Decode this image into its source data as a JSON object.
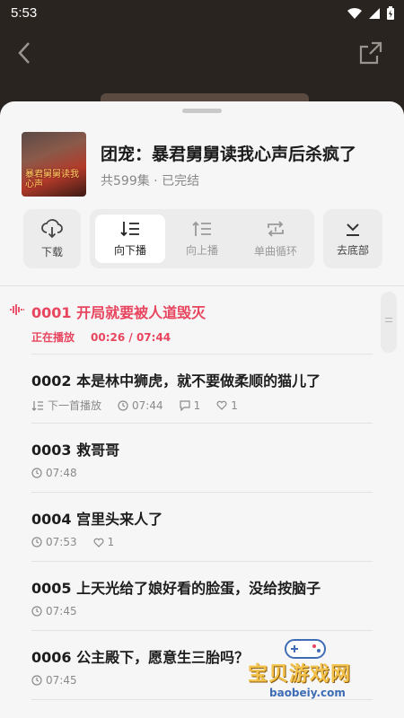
{
  "status": {
    "time": "5:53"
  },
  "book": {
    "title": "团宠：暴君舅舅读我心声后杀疯了",
    "meta": "共599集 · 已完结",
    "cover_text": "暴君舅舅读我心声"
  },
  "controls": {
    "download": "下载",
    "play_down": "向下播",
    "play_up": "向上播",
    "single_loop": "单曲循环",
    "to_bottom": "去底部"
  },
  "episodes": [
    {
      "title": "0001 开局就要被人道毁灭",
      "status": "正在播放",
      "progress": "00:26 / 07:44"
    },
    {
      "title": "0002 本是林中狮虎，就不要做柔顺的猫儿了",
      "next": "下一首播放",
      "duration": "07:44",
      "comments": "1",
      "likes": "1"
    },
    {
      "title": "0003 救哥哥",
      "duration": "07:48"
    },
    {
      "title": "0004 宫里头来人了",
      "duration": "07:53",
      "likes": "1"
    },
    {
      "title": "0005 上天光给了娘好看的脸蛋，没给按脑子",
      "duration": "07:45"
    },
    {
      "title": "0006 公主殿下，愿意生三胎吗？",
      "duration": "07:45"
    }
  ],
  "watermark": {
    "name": "宝贝游戏网",
    "url": "baobeiy.com"
  },
  "colors": {
    "accent": "#e8455f",
    "sheet": "#f6f6f6",
    "backdrop": "#2a2421"
  }
}
